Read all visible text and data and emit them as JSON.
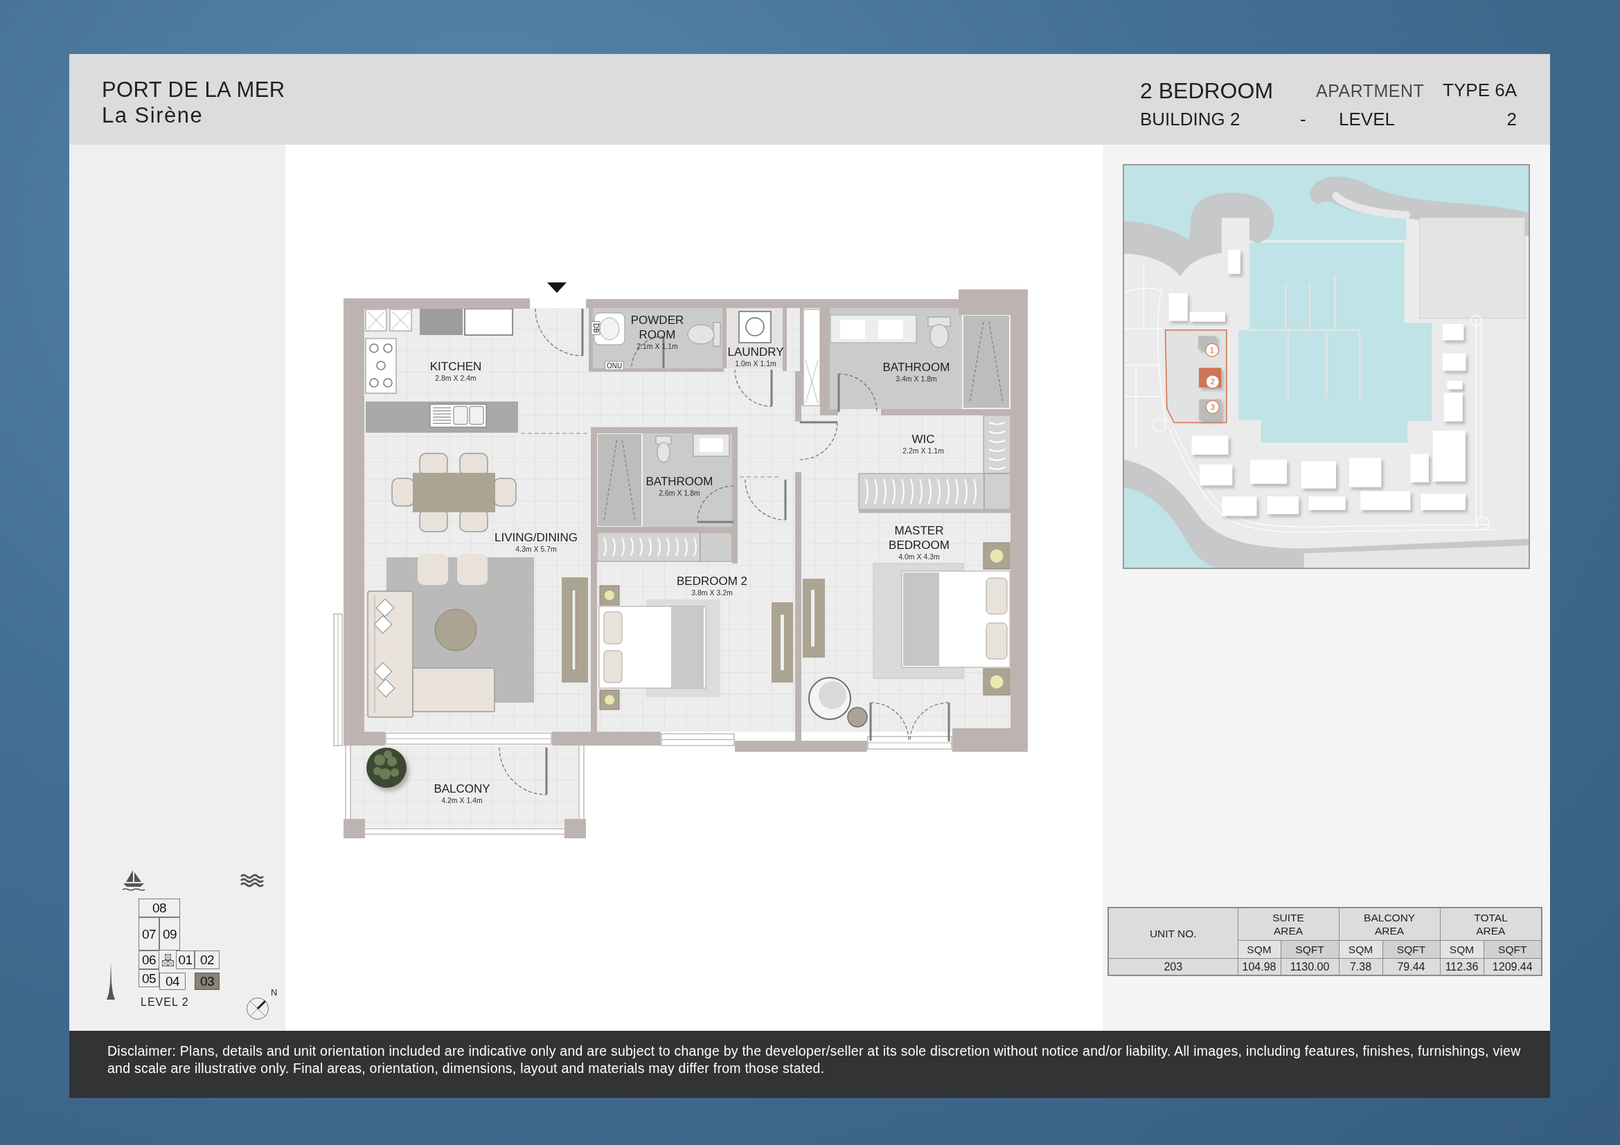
{
  "header": {
    "project": "PORT DE LA MER",
    "building_name": "La Sirène",
    "unit_type": "2 BEDROOM",
    "apartment_label": "APARTMENT",
    "apartment_type": "TYPE 6A",
    "building": "BUILDING 2",
    "separator": "-",
    "level_label": "LEVEL",
    "level": "2"
  },
  "floor_plan": {
    "rooms": [
      {
        "name": "POWDER ROOM",
        "dimensions": "2.1m X 1.1m"
      },
      {
        "name": "LAUNDRY",
        "dimensions": "1.0m X 1.1m"
      },
      {
        "name": "KITCHEN",
        "dimensions": "2.8m X 2.4m"
      },
      {
        "name": "BATHROOM",
        "dimensions": "3.4m X 1.8m"
      },
      {
        "name": "WIC",
        "dimensions": "2.2m X 1.1m"
      },
      {
        "name": "BATHROOM",
        "dimensions": "2.6m X 1.8m"
      },
      {
        "name": "LIVING/DINING",
        "dimensions": "4.3m X 5.7m"
      },
      {
        "name": "MASTER BEDROOM",
        "dimensions": "4.0m X 4.3m"
      },
      {
        "name": "BEDROOM 2",
        "dimensions": "3.8m X 3.2m"
      },
      {
        "name": "BALCONY",
        "dimensions": "4.2m X 1.4m"
      }
    ],
    "fixture_labels": [
      "DB",
      "ONU"
    ]
  },
  "site_plan": {
    "buildings": [
      {
        "label": "1",
        "selected": false
      },
      {
        "label": "2",
        "selected": true
      },
      {
        "label": "3",
        "selected": false
      }
    ]
  },
  "key_plan": {
    "units": [
      {
        "label": "08",
        "selected": false
      },
      {
        "label": "07",
        "selected": false
      },
      {
        "label": "09",
        "selected": false
      },
      {
        "label": "06",
        "selected": false
      },
      {
        "label": "01",
        "selected": false
      },
      {
        "label": "02",
        "selected": false
      },
      {
        "label": "05",
        "selected": false
      },
      {
        "label": "04",
        "selected": false
      },
      {
        "label": "03",
        "selected": true
      }
    ],
    "level": "LEVEL 2",
    "compass_label": "N"
  },
  "area_table": {
    "columns": [
      {
        "label": "UNIT NO."
      },
      {
        "label": "SUITE AREA",
        "colspan": 2,
        "subcolumns": [
          "SQM",
          "SQFT"
        ]
      },
      {
        "label": "BALCONY AREA",
        "colspan": 2,
        "subcolumns": [
          "SQM",
          "SQFT"
        ]
      },
      {
        "label": "TOTAL AREA",
        "colspan": 2,
        "subcolumns": [
          "SQM",
          "SQFT"
        ]
      }
    ],
    "rows": [
      [
        "203",
        "104.98",
        "1130.00",
        "7.38",
        "79.44",
        "112.36",
        "1209.44"
      ]
    ]
  },
  "disclaimer": "Disclaimer: Plans, details and unit orientation included are indicative only and are subject to change by the developer/seller at its sole discretion without notice and/or liability. All images, including features, finishes, furnishings, view and scale are illustrative only. Final areas, orientation, dimensions, layout and materials may differ from those stated."
}
